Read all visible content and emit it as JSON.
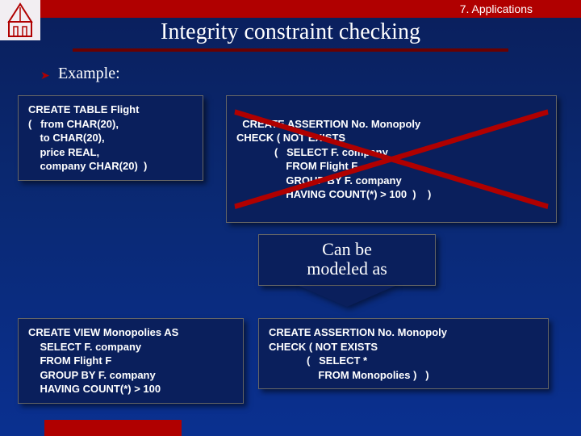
{
  "header": {
    "chapter": "7.  Applications"
  },
  "title": "Integrity constraint checking",
  "example_label": "Example:",
  "code": {
    "create_table": "CREATE TABLE Flight\n(   from CHAR(20),\n    to CHAR(20),\n    price REAL,\n    company CHAR(20)  )",
    "assertion_long": "CREATE ASSERTION No. Monopoly\nCHECK ( NOT EXISTS\n             (   SELECT F. company\n                 FROM Flight F\n                 GROUP BY F. company\n                 HAVING COUNT(*) > 100  )    )",
    "create_view": "CREATE VIEW Monopolies AS\n    SELECT F. company\n    FROM Flight F\n    GROUP BY F. company\n    HAVING COUNT(*) > 100",
    "assertion_short": "CREATE ASSERTION No. Monopoly\nCHECK ( NOT EXISTS\n             (   SELECT *\n                 FROM Monopolies )   )"
  },
  "callout": {
    "line1": "Can be",
    "line2": "modeled as"
  }
}
